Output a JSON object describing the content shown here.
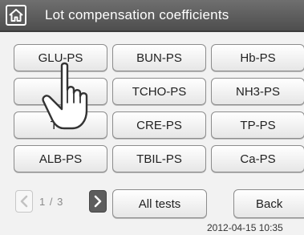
{
  "header": {
    "title": "Lot compensation coefficients",
    "home_icon": "home-icon"
  },
  "grid": {
    "rows": [
      [
        "GLU-PS",
        "BUN-PS",
        "Hb-PS"
      ],
      [
        "",
        "TCHO-PS",
        "NH3-PS"
      ],
      [
        "TG-",
        "CRE-PS",
        "TP-PS"
      ],
      [
        "ALB-PS",
        "TBIL-PS",
        "Ca-PS"
      ]
    ]
  },
  "pagination": {
    "current": "1",
    "separator": "/",
    "total": "3",
    "prev_icon": "chevron-left-icon",
    "next_icon": "chevron-right-icon"
  },
  "footer": {
    "all_tests_label": "All tests",
    "back_label": "Back",
    "timestamp": "2012-04-15 10:35"
  },
  "overlay": {
    "hand_icon": "pointing-hand-icon"
  },
  "colors": {
    "header_bg": "#5a5a5a",
    "content_bg": "#f2f2f2",
    "button_border": "#8c8c8c",
    "next_button_bg": "#5d5d5d"
  }
}
